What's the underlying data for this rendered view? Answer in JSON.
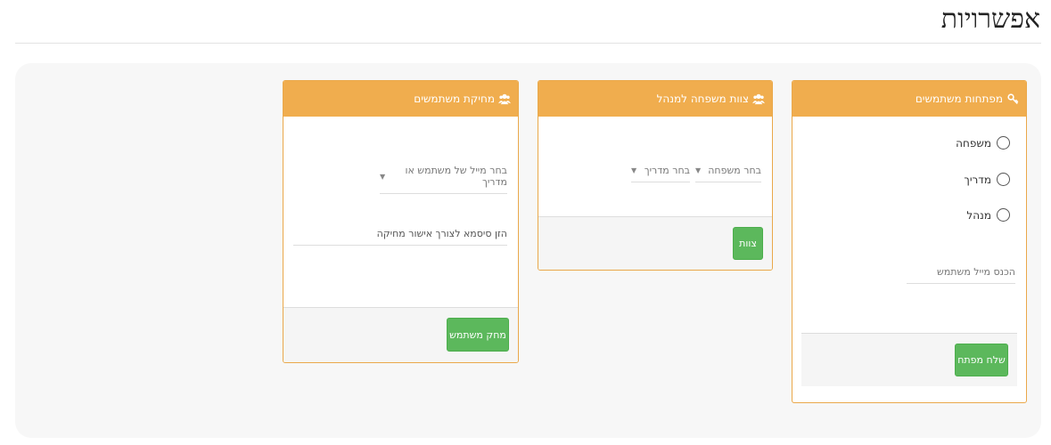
{
  "page": {
    "title": "אפשרויות"
  },
  "cards": {
    "keys": {
      "title": "מפתחות משתמשים",
      "options": [
        "משפחה",
        "מדריך",
        "מנהל"
      ],
      "email_placeholder": "הכנס מייל משתמש",
      "send_button": "שלח מפתח"
    },
    "assign": {
      "title": "צוות משפחה למנהל",
      "family_select": "בחר משפחה",
      "guide_select": "בחר מדריך",
      "assign_button": "צוות"
    },
    "delete": {
      "title": "מחיקת משתמשים",
      "user_select": "בחר מייל של משתמש או מדריך",
      "password_placeholder": "הזן סיסמא לצורך אישור מחיקה",
      "delete_button": "מחק משתמש"
    }
  },
  "icons": {
    "keys": "key-icon",
    "assign": "users-icon",
    "delete": "users-icon"
  },
  "colors": {
    "header": "#f0ad4e",
    "button": "#5cb85c",
    "title": "#222222"
  }
}
